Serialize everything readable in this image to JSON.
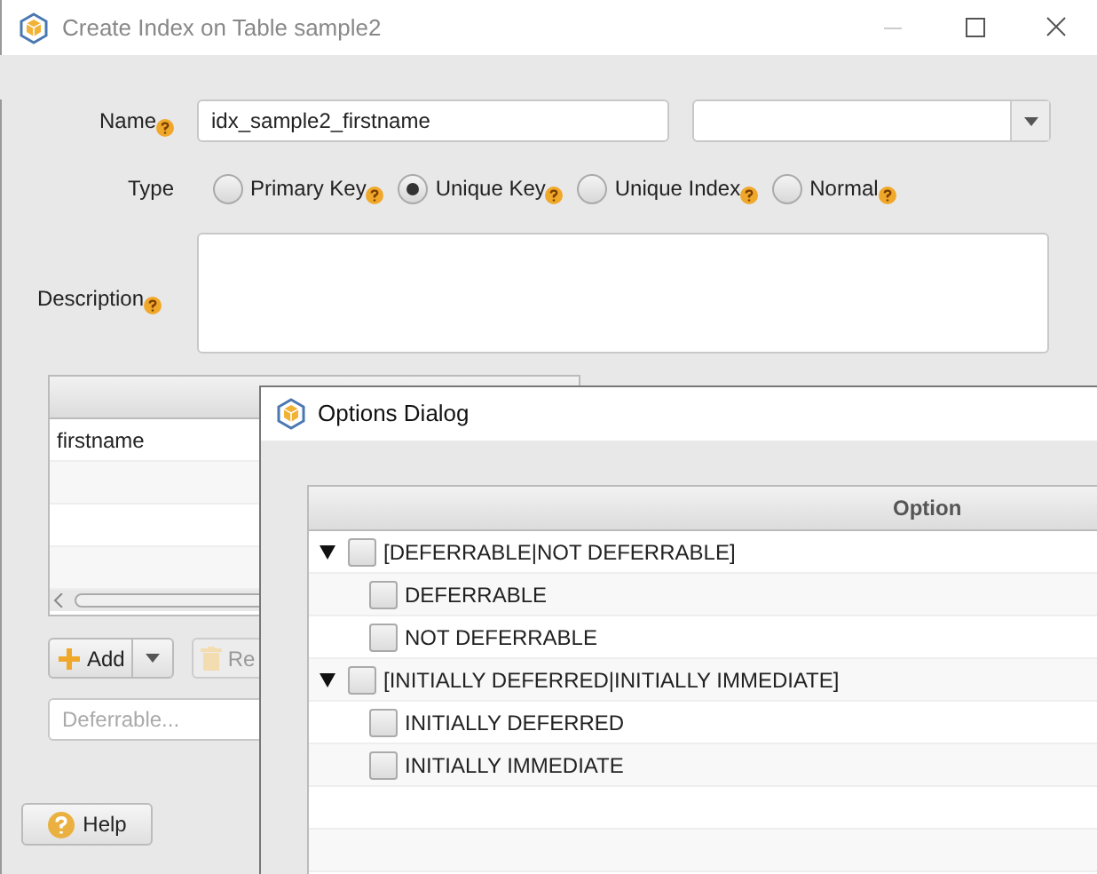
{
  "window": {
    "title": "Create Index on Table sample2"
  },
  "form": {
    "name_label": "Name",
    "name_value": "idx_sample2_firstname",
    "type_label": "Type",
    "type_options": [
      {
        "label": "Primary Key",
        "selected": false
      },
      {
        "label": "Unique Key",
        "selected": true
      },
      {
        "label": "Unique Index",
        "selected": false
      },
      {
        "label": "Normal",
        "selected": false
      }
    ],
    "description_label": "Description"
  },
  "columns_table": {
    "rows": [
      "firstname"
    ]
  },
  "add_button": "Add",
  "remove_button": "Re",
  "filter": {
    "placeholder": "Deferrable..."
  },
  "help_button": "Help",
  "options_dialog": {
    "title": "Options Dialog",
    "column": "Option",
    "items": [
      {
        "label": "[DEFERRABLE|NOT DEFERRABLE]",
        "checked": false,
        "expanded": true,
        "children": [
          {
            "label": "DEFERRABLE",
            "checked": false
          },
          {
            "label": "NOT DEFERRABLE",
            "checked": false
          }
        ]
      },
      {
        "label": "[INITIALLY DEFERRED|INITIALLY IMMEDIATE]",
        "checked": false,
        "expanded": true,
        "children": [
          {
            "label": "INITIALLY DEFERRED",
            "checked": false
          },
          {
            "label": "INITIALLY IMMEDIATE",
            "checked": false
          }
        ]
      }
    ]
  }
}
